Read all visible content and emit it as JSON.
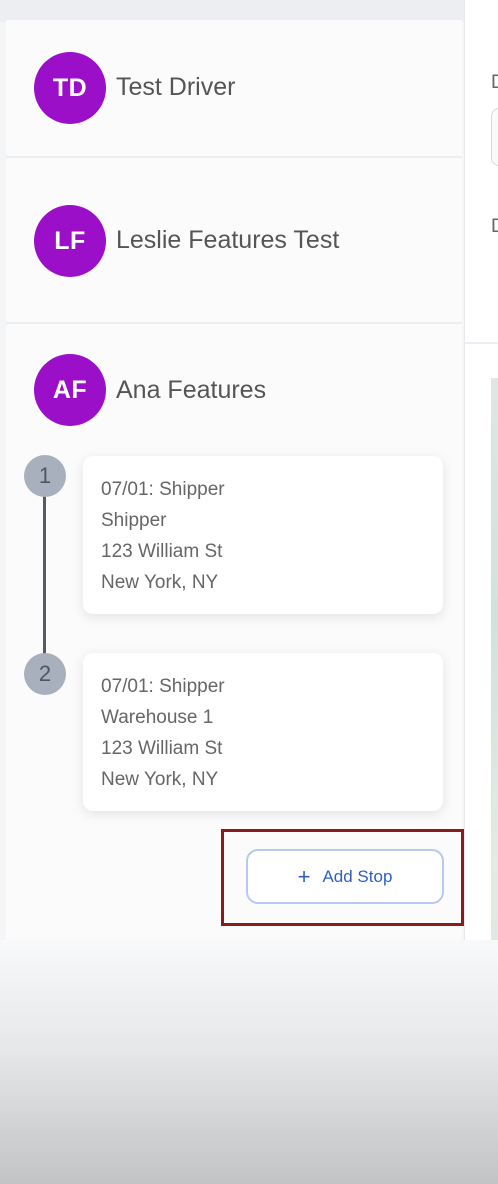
{
  "drivers": [
    {
      "initials": "TD",
      "name": "Test Driver"
    },
    {
      "initials": "LF",
      "name": "Leslie Features Test"
    },
    {
      "initials": "AF",
      "name": "Ana Features"
    }
  ],
  "stops": [
    {
      "number": "1",
      "date_type": "07/01: Shipper",
      "location": "Shipper",
      "address": "123 William St",
      "city": "New York, NY"
    },
    {
      "number": "2",
      "date_type": "07/01: Shipper",
      "location": "Warehouse 1",
      "address": "123 William St",
      "city": "New York, NY"
    }
  ],
  "add_stop": {
    "icon": "plus-icon",
    "label": "Add Stop"
  },
  "right_panel": {
    "frag_1": "D",
    "frag_2": "D"
  },
  "colors": {
    "avatar": "#9b0fc9",
    "accent": "#2d5fc4",
    "highlight": "#8b1a1a",
    "stop_badge": "#a9b0bd"
  }
}
